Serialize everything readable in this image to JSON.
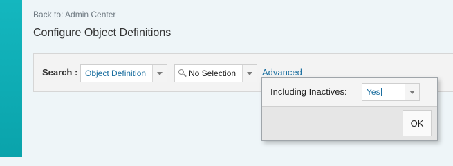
{
  "header": {
    "back_link": "Back to: Admin Center",
    "title": "Configure Object Definitions"
  },
  "search": {
    "label": "Search :",
    "object_type": {
      "value": "Object Definition",
      "icon": "chevron-down-icon"
    },
    "object": {
      "value": "No Selection",
      "icon": "search-icon"
    },
    "advanced_label": "Advanced"
  },
  "advanced_popup": {
    "inactives_label": "Including Inactives:",
    "inactives_value": "Yes",
    "ok_label": "OK"
  },
  "colors": {
    "rail": "#0aa3ab",
    "link": "#1b6fa0",
    "page_bg": "#eef5f8"
  }
}
